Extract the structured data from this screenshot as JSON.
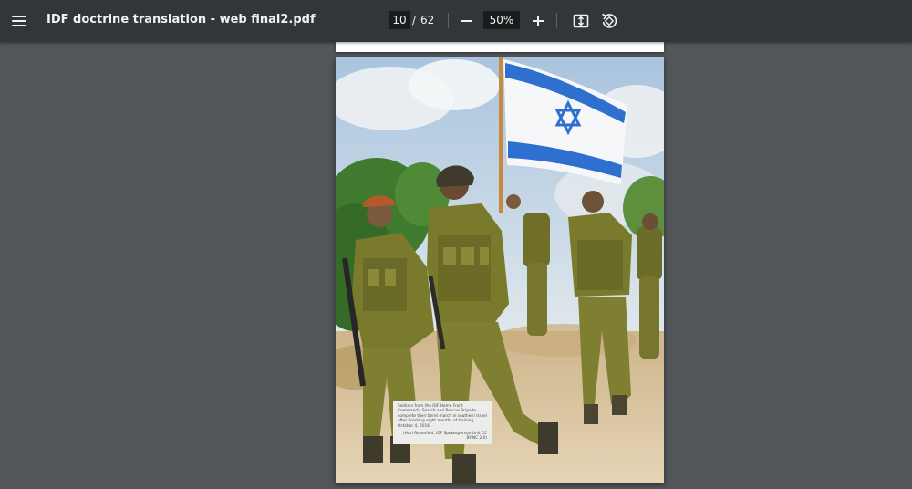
{
  "toolbar": {
    "title": "IDF doctrine translation - web final2.pdf",
    "page_current": "10",
    "page_separator": "/",
    "page_total": "62",
    "zoom": "50%"
  },
  "page": {
    "caption": "Soldiers from the IDF Home Front Command's Search and Rescue Brigade complete their beret march in southern Israel after finishing eight months of training, October 4, 2016.",
    "credit": "(Hasi Rosenfeld, IDF Spokesperson Unit CC BY-NC 2.0)"
  },
  "colors": {
    "toolbar_bg": "#323639",
    "viewer_bg": "#525659",
    "flag_blue": "#2f6fcf",
    "uniform_olive": "#7a7a2c"
  },
  "icons": {
    "menu": "hamburger-icon",
    "zoom_out": "minus-icon",
    "zoom_in": "plus-icon",
    "fit": "fit-to-page-icon",
    "rotate": "rotate-icon"
  }
}
